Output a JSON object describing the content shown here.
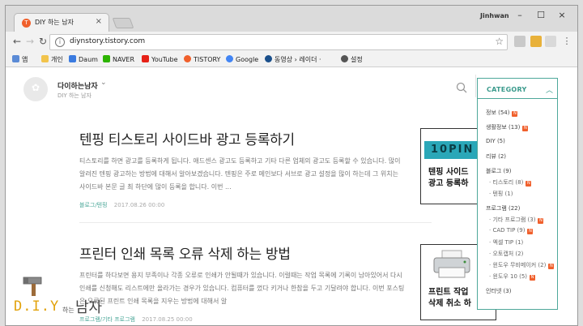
{
  "browser": {
    "tab_title": "DIY 하는 남자",
    "tab_favicon": "T",
    "user_name": "Jinhwan",
    "url": "diynstory.tistory.com",
    "bookmarks": [
      {
        "label": "앱",
        "color": "#5b8bd6"
      },
      {
        "label": "개인",
        "color": "#f2c44c"
      },
      {
        "label": "Daum",
        "color": "#3b7be0"
      },
      {
        "label": "NAVER",
        "color": "#2db400"
      },
      {
        "label": "YouTube",
        "color": "#e62117"
      },
      {
        "label": "TISTORY",
        "color": "#f0602c"
      },
      {
        "label": "Google",
        "color": "#4285f4"
      },
      {
        "label": "동영상 › 레이더 ·",
        "color": "#1a4f8b"
      },
      {
        "label": "설정",
        "color": "#555555"
      }
    ],
    "icons": {
      "back": "←",
      "forward": "→",
      "reload": "↻",
      "info": "i",
      "star": "☆",
      "close": "×",
      "minimize": "–",
      "maximize": "☐"
    }
  },
  "blog": {
    "name": "다이하는남자",
    "subtitle": "DIY 하는 남자",
    "chevron": "⌄"
  },
  "posts": [
    {
      "title": "텐핑 티스토리 사이드바 광고 등록하기",
      "excerpt": "티스토리를 하면 광고를 등록하게 됩니다. 애드센스 광고도 등록하고 기타 다른 업체의 광고도 등록할 수 있습니다. 많이 알려진 텐핑 광고하는 방법에 대해서 알아보겠습니다. 텐핑은 주로 메인보다 서브로 광고 설정을 많이 하는데 그 위치는 사이드바 본문 글 최 하단에 많이 등록을 합니다. 이번 ...",
      "category": "블로그/텐핑",
      "date": "2017.08.26 00:00",
      "thumb_top": "10PIN",
      "thumb_line1": "텐핑 사이드",
      "thumb_line2": "광고 등록하"
    },
    {
      "title": "프린터 인쇄 목록 오류 삭제 하는 방법",
      "excerpt": "프린터를 하다보면 용지 부족이나 각종 오류로 인쇄가 안될때가 있습니다. 이럴때는 작업 목록에 기록이 남아있어서 다시 인쇄를 신청해도 리스트에만 올라가는 경우가 있습니다. 컴퓨터를 껐다 키거나 한참을 두고 기달려야 합니다.  이번 포스팅은 오류된 프린트 인쇄 목록을 지우는 방법에 대해서 알",
      "category": "프로그램/기타 프로그램",
      "date": "2017.08.25 00:00",
      "thumb_line1": "프린트 작업",
      "thumb_line2": "삭제 취소 하"
    }
  ],
  "category": {
    "header": "CATEGORY",
    "items": [
      {
        "label": "정보 (54)",
        "sub": false,
        "new": true
      },
      {
        "label": "생활정보 (13)",
        "sub": false,
        "new": true
      },
      {
        "label": "DIY (5)",
        "sub": false,
        "new": false
      },
      {
        "label": "리뷰 (2)",
        "sub": false,
        "new": false
      },
      {
        "label": "블로그 (9)",
        "sub": false,
        "new": false
      },
      {
        "label": "· 티스토리 (8)",
        "sub": true,
        "new": true
      },
      {
        "label": "· 텐핑 (1)",
        "sub": true,
        "new": false
      },
      {
        "label": "프로그램 (22)",
        "sub": false,
        "new": false
      },
      {
        "label": "· 기타 프로그램 (3)",
        "sub": true,
        "new": true
      },
      {
        "label": "· CAD TIP (9)",
        "sub": true,
        "new": true
      },
      {
        "label": "· 엑셀 TIP (1)",
        "sub": true,
        "new": false
      },
      {
        "label": "· 오토캡처 (2)",
        "sub": true,
        "new": false
      },
      {
        "label": "· 윈도우 무비메이커 (2)",
        "sub": true,
        "new": true
      },
      {
        "label": "· 윈도우 10 (5)",
        "sub": true,
        "new": true
      },
      {
        "label": "인터넷 (3)",
        "sub": false,
        "new": false
      }
    ]
  },
  "logo": {
    "diy": "D.I.Y",
    "small": "하는",
    "big": "남자"
  },
  "colors": {
    "accent": "#4ea89a",
    "tistory": "#f0602c",
    "diy": "#e2a20b"
  }
}
